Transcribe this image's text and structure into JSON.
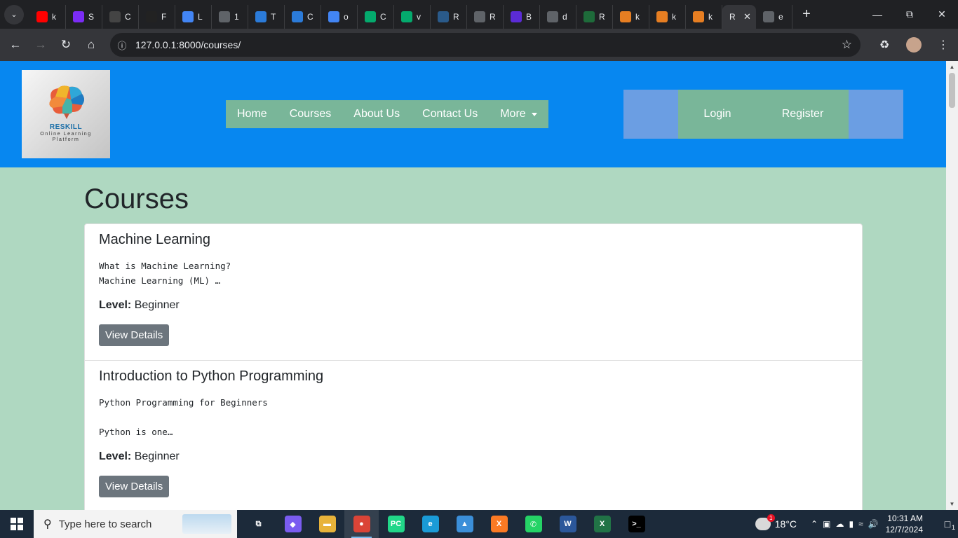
{
  "browser": {
    "tabs": [
      {
        "title": "k",
        "icon": "youtube-icon",
        "color": "#ff0000"
      },
      {
        "title": "S",
        "icon": "bootstrap-icon",
        "color": "#7b2cf5"
      },
      {
        "title": "C",
        "icon": "chatgpt-icon",
        "color": "#444444"
      },
      {
        "title": "F",
        "icon": "github-icon",
        "color": "#222222"
      },
      {
        "title": "L",
        "icon": "google-icon",
        "color": "#4285f4"
      },
      {
        "title": "1",
        "icon": "globe-icon",
        "color": "#5f6368"
      },
      {
        "title": "T",
        "icon": "copilot-icon",
        "color": "#2b7bd9"
      },
      {
        "title": "C",
        "icon": "copilot-icon",
        "color": "#2b7bd9"
      },
      {
        "title": "o",
        "icon": "google-icon",
        "color": "#4285f4"
      },
      {
        "title": "C",
        "icon": "w3schools-icon",
        "color": "#04aa6d"
      },
      {
        "title": "v",
        "icon": "w3schools-icon",
        "color": "#04aa6d"
      },
      {
        "title": "R",
        "icon": "rs-icon",
        "color": "#2a5a8a"
      },
      {
        "title": "R",
        "icon": "globe-icon",
        "color": "#5f6368"
      },
      {
        "title": "B",
        "icon": "m-icon",
        "color": "#5b2bd6"
      },
      {
        "title": "d",
        "icon": "db-icon",
        "color": "#5f6368"
      },
      {
        "title": "R",
        "icon": "rs-icon",
        "color": "#1e6b3a"
      },
      {
        "title": "k",
        "icon": "sail-icon",
        "color": "#e67e22"
      },
      {
        "title": "k",
        "icon": "sail-icon",
        "color": "#e67e22"
      },
      {
        "title": "k",
        "icon": "sail-icon",
        "color": "#e67e22"
      }
    ],
    "active_tab": {
      "title": "R"
    },
    "last_tab": {
      "title": "e",
      "icon": "globe-icon"
    },
    "url": "127.0.0.1:8000/courses/"
  },
  "site": {
    "logo": {
      "brand": "RESKILL",
      "tagline": "Online Learning Platform"
    },
    "nav": {
      "home": "Home",
      "courses": "Courses",
      "about": "About Us",
      "contact": "Contact Us",
      "more": "More"
    },
    "auth": {
      "login": "Login",
      "register": "Register"
    },
    "colors": {
      "header": "#0787f0",
      "nav": "#79b699",
      "auth_outer": "#6b9ee3",
      "page_bg": "#afd8c1"
    }
  },
  "page": {
    "title": "Courses",
    "courses": [
      {
        "title": "Machine Learning",
        "summary": "What is Machine Learning?\nMachine Learning (ML) …",
        "level_label": "Level:",
        "level": "Beginner",
        "button": "View Details"
      },
      {
        "title": "Introduction to Python Programming",
        "summary": "Python Programming for Beginners\n\nPython is one…",
        "level_label": "Level:",
        "level": "Beginner",
        "button": "View Details"
      }
    ]
  },
  "taskbar": {
    "search_placeholder": "Type here to search",
    "apps": [
      {
        "name": "task-view-icon",
        "label": "⧉",
        "color": "#1c2a3a"
      },
      {
        "name": "copilot-app-icon",
        "label": "◆",
        "color": "#7a5cf0"
      },
      {
        "name": "file-explorer-icon",
        "label": "▬",
        "color": "#e8b33a"
      },
      {
        "name": "chrome-icon",
        "label": "●",
        "color": "#db4437"
      },
      {
        "name": "pycharm-icon",
        "label": "PC",
        "color": "#21d789"
      },
      {
        "name": "edge-icon",
        "label": "e",
        "color": "#1a9bd7"
      },
      {
        "name": "photos-icon",
        "label": "▲",
        "color": "#3b8fd9"
      },
      {
        "name": "xampp-icon",
        "label": "X",
        "color": "#fb7a24"
      },
      {
        "name": "whatsapp-icon",
        "label": "✆",
        "color": "#25d366"
      },
      {
        "name": "word-icon",
        "label": "W",
        "color": "#2b579a"
      },
      {
        "name": "excel-icon",
        "label": "X",
        "color": "#217346"
      },
      {
        "name": "terminal-icon",
        "label": ">_",
        "color": "#000000"
      }
    ],
    "weather": {
      "temp": "18°C",
      "badge": "1"
    },
    "clock": {
      "time": "10:31 AM",
      "date": "12/7/2024"
    },
    "notifications": "1"
  }
}
